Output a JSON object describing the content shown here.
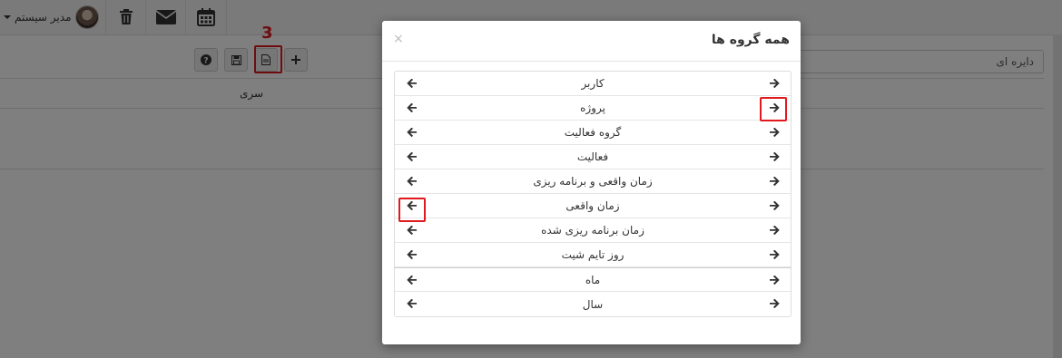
{
  "navbar": {
    "user_name": "مدیر سیستم",
    "icons": [
      "trash-icon",
      "envelope-icon",
      "calendar-icon"
    ]
  },
  "toolbar": {
    "buttons": [
      "help-icon",
      "save-icon",
      "document-icon",
      "plus-icon"
    ],
    "step_marker": "3"
  },
  "background_page": {
    "column_header": "سری",
    "dropdown_value": "دایره ای"
  },
  "modal": {
    "title": "همه گروه ها",
    "close_symbol": "×",
    "groups": [
      "کاربر",
      "پروژه",
      "گروه فعالیت",
      "فعالیت",
      "زمان واقعی و برنامه ریزی",
      "زمان واقعی",
      "زمان برنامه ریزی شده",
      "روز تایم شیت",
      "ماه",
      "سال"
    ]
  },
  "colors": {
    "highlight": "#e0191e",
    "backdrop": "#808080"
  }
}
